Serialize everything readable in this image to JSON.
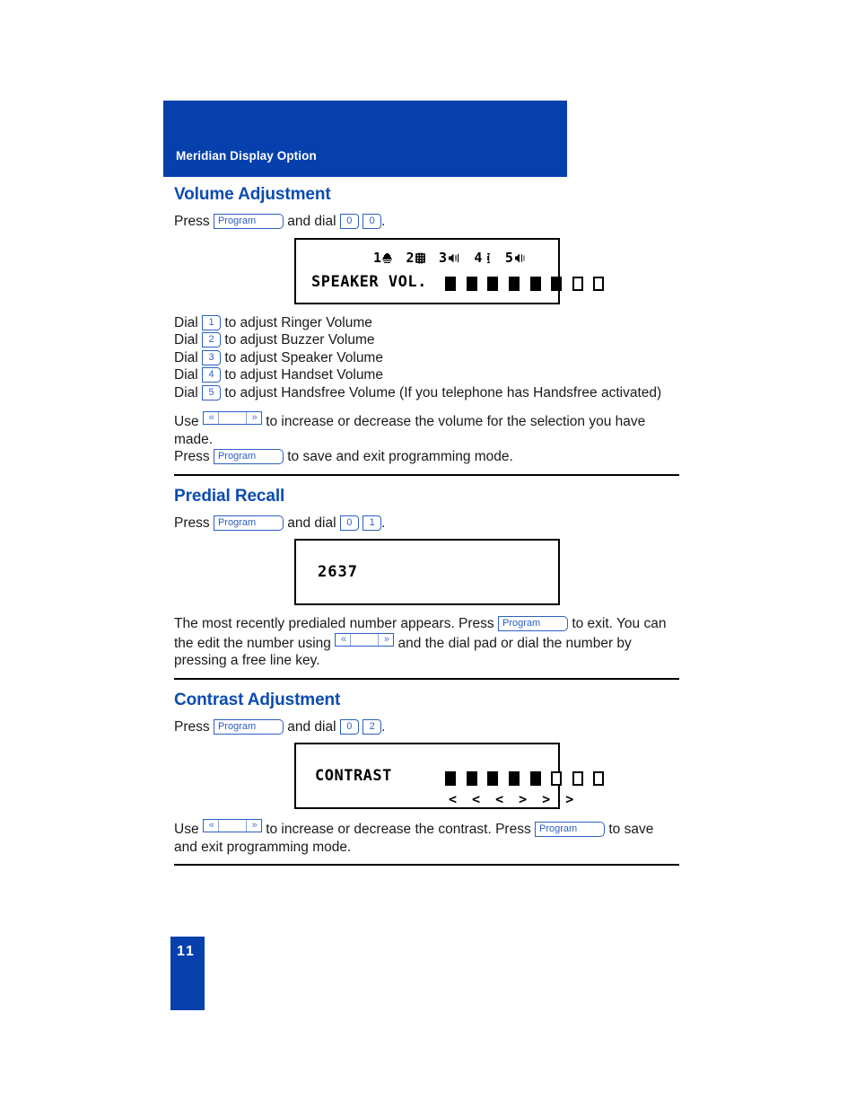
{
  "header": {
    "title": "Meridian Display Option"
  },
  "page": {
    "number": "11"
  },
  "keys": {
    "program": "Program",
    "digit_0": "0",
    "digit_1": "1",
    "digit_2": "2",
    "digit_3": "3",
    "digit_4": "4",
    "digit_5": "5",
    "rocker_left": "«",
    "rocker_right": "»"
  },
  "colors": {
    "brand_blue": "#0540ad",
    "heading_blue": "#0b4cb0",
    "key_blue": "#2b5fc4"
  },
  "sections": [
    {
      "id": "volume-adjustment",
      "heading": "Volume Adjustment",
      "intro_prefix": "Press",
      "intro_middle": "and dial",
      "intro_suffix": ".",
      "lcd": {
        "icon_row": [
          {
            "number": "1",
            "icon": "bell-icon"
          },
          {
            "number": "2",
            "icon": "buzzer-icon"
          },
          {
            "number": "3",
            "icon": "speaker-icon"
          },
          {
            "number": "4",
            "icon": "handset-icon"
          },
          {
            "number": "5",
            "icon": "handsfree-icon"
          }
        ],
        "label": "SPEAKER VOL.",
        "bars_total": 8,
        "bars_filled": 6
      },
      "dial_list": [
        {
          "prefix": "Dial",
          "key": "1",
          "text": "to adjust Ringer Volume"
        },
        {
          "prefix": "Dial",
          "key": "2",
          "text": "to adjust Buzzer Volume"
        },
        {
          "prefix": "Dial",
          "key": "3",
          "text": "to adjust Speaker Volume"
        },
        {
          "prefix": "Dial",
          "key": "4",
          "text": "to adjust Handset Volume"
        },
        {
          "prefix": "Dial",
          "key": "5",
          "text": "to adjust Handsfree Volume (If you telephone has Handsfree activated)"
        }
      ],
      "outro_line1_prefix": "Use",
      "outro_line1_suffix": "to increase or decrease the volume for the selection you have made.",
      "outro_line2_prefix": "Press",
      "outro_line2_suffix": "to save and exit programming mode."
    },
    {
      "id": "predial-recall",
      "heading": "Predial Recall",
      "intro_prefix": "Press",
      "intro_middle": "and dial",
      "intro_suffix": ".",
      "lcd": {
        "number": "2637"
      },
      "body_part1": "The most recently predialed number appears. Press",
      "body_part2": "to exit. You can the edit the number using",
      "body_part3": "and the dial pad or dial the number by pressing a free line key."
    },
    {
      "id": "contrast-adjustment",
      "heading": "Contrast Adjustment",
      "intro_prefix": "Press",
      "intro_middle": "and dial",
      "intro_suffix": ".",
      "lcd": {
        "label": "CONTRAST",
        "bars_total": 8,
        "bars_filled": 5,
        "arrows": "< < <  > > >"
      },
      "outro_part1": "Use",
      "outro_part2": "to increase or decrease the contrast. Press",
      "outro_part3": "to save and exit programming mode."
    }
  ]
}
